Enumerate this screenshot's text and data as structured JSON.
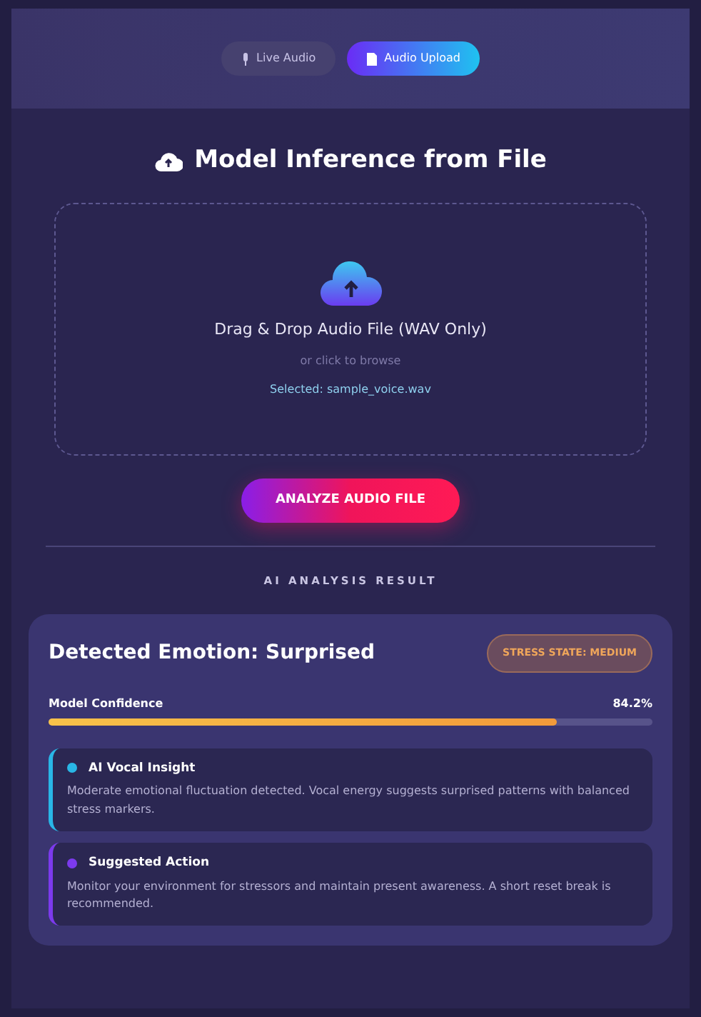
{
  "tabs": [
    {
      "label": "Live Audio",
      "selected": false
    },
    {
      "label": "Audio Upload",
      "selected": true
    }
  ],
  "title": "Model Inference from File",
  "dropzone": {
    "heading": "Drag & Drop Audio File (WAV Only)",
    "hint": "or click to browse",
    "selected_file": "Selected: sample_voice.wav"
  },
  "analyze_button": "ANALYZE AUDIO FILE",
  "section_label": "AI ANALYSIS RESULT",
  "result": {
    "emotion": "Detected Emotion: Surprised",
    "stress_badge": "STRESS STATE: MEDIUM",
    "confidence": {
      "label": "Model Confidence",
      "reading": "84.2%",
      "level": 0.842
    },
    "insights": [
      {
        "title": "AI Vocal Insight",
        "color": "#29b6e6",
        "text": "Moderate emotional fluctuation detected. Vocal energy suggests surprised patterns with balanced stress markers."
      },
      {
        "title": "Suggested Action",
        "color": "#7c3aed",
        "text": "Monitor your environment for stressors and maintain present awareness. A short reset break is recommended."
      }
    ]
  }
}
